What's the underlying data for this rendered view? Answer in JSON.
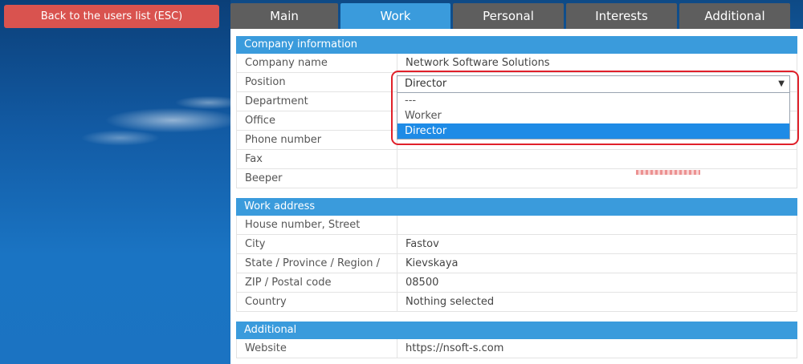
{
  "back_button": "Back to the users list (ESC)",
  "tabs": [
    {
      "label": "Main",
      "active": false
    },
    {
      "label": "Work",
      "active": true
    },
    {
      "label": "Personal",
      "active": false
    },
    {
      "label": "Interests",
      "active": false
    },
    {
      "label": "Additional",
      "active": false
    }
  ],
  "company": {
    "header": "Company information",
    "rows": [
      {
        "label": "Company name",
        "value": "Network Software Solutions"
      },
      {
        "label": "Position",
        "value": ""
      },
      {
        "label": "Department",
        "value": ""
      },
      {
        "label": "Office",
        "value": ""
      },
      {
        "label": "Phone number",
        "value": ""
      },
      {
        "label": "Fax",
        "value": ""
      },
      {
        "label": "Beeper",
        "value": ""
      }
    ],
    "position_select": {
      "selected": "Director",
      "options": [
        "---",
        "Worker",
        "Director"
      ],
      "selected_index": 2
    }
  },
  "work_address": {
    "header": "Work address",
    "rows": [
      {
        "label": "House number, Street",
        "value": ""
      },
      {
        "label": "City",
        "value": "Fastov"
      },
      {
        "label": "State / Province / Region /",
        "value": "Kievskaya"
      },
      {
        "label": "ZIP / Postal code",
        "value": "08500"
      },
      {
        "label": "Country",
        "value": "Nothing selected"
      }
    ]
  },
  "additional": {
    "header": "Additional",
    "rows": [
      {
        "label": "Website",
        "value": "https://nsoft-s.com"
      }
    ]
  },
  "colors": {
    "accent": "#3a9bdc",
    "back_button": "#d9534f",
    "tab_inactive": "#5e5e5e",
    "highlight": "#e0202a"
  }
}
